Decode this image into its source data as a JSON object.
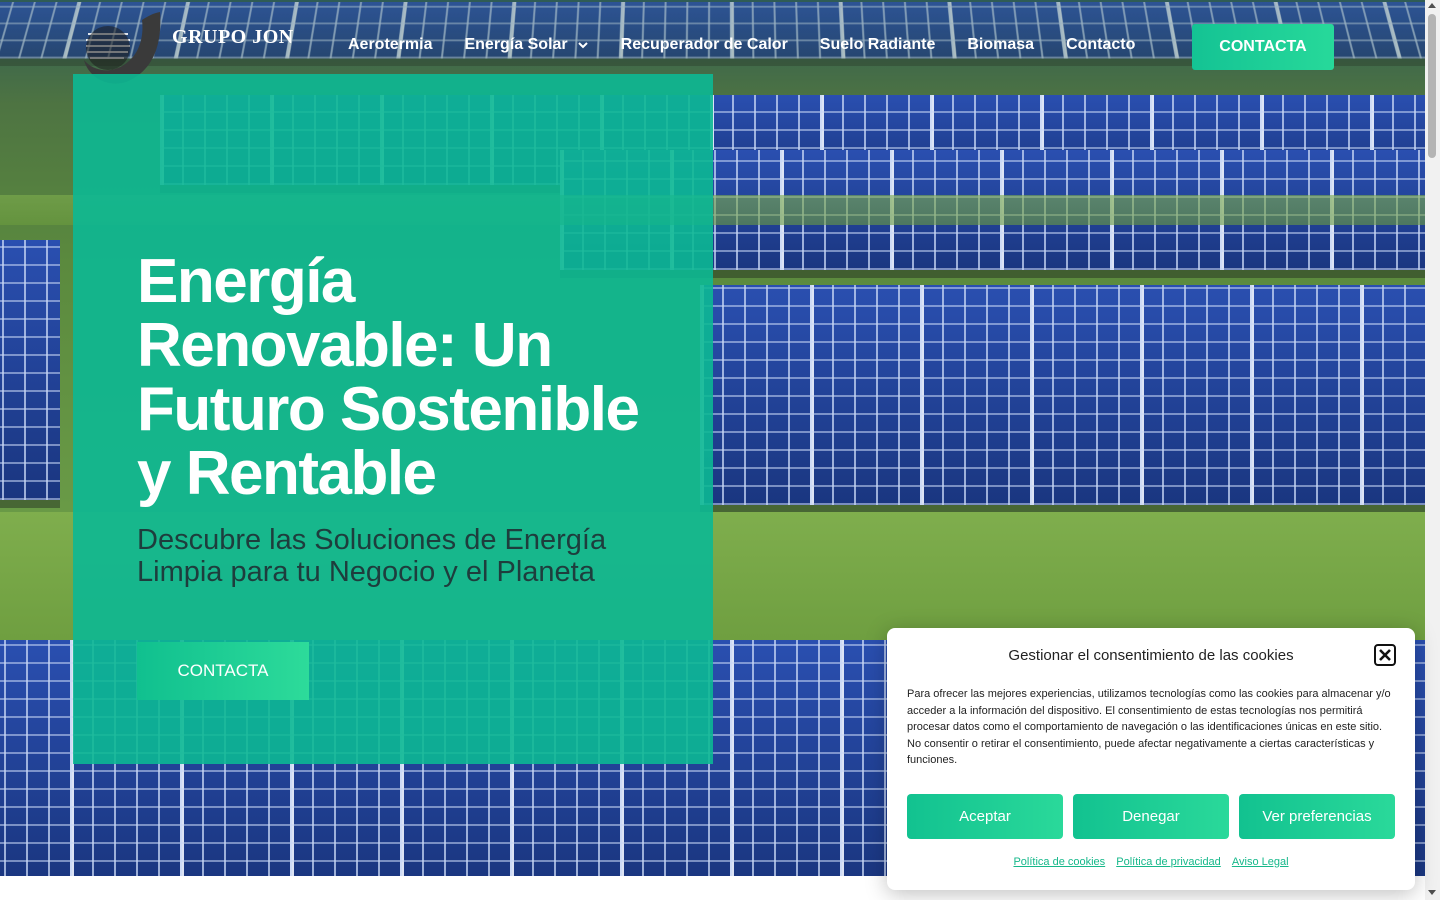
{
  "header": {
    "logo_text": "GRUPO JON",
    "nav": [
      {
        "label": "Aerotermia"
      },
      {
        "label": "Energía Solar",
        "has_dropdown": true
      },
      {
        "label": "Recuperador de Calor"
      },
      {
        "label": "Suelo Radiante"
      },
      {
        "label": "Biomasa"
      },
      {
        "label": "Contacto"
      }
    ],
    "cta_label": "CONTACTA"
  },
  "hero": {
    "title": "Energía Renovable: Un Futuro Sostenible y Rentable",
    "subtitle": "Descubre las Soluciones de Energía Limpia para tu Negocio y el Planeta",
    "cta_label": "CONTACTA"
  },
  "cookie_dialog": {
    "title": "Gestionar el consentimiento de las cookies",
    "text": "Para ofrecer las mejores experiencias, utilizamos tecnologías como las cookies para almacenar y/o acceder a la información del dispositivo. El consentimiento de estas tecnologías nos permitirá procesar datos como el comportamiento de navegación o las identificaciones únicas en este sitio. No consentir o retirar el consentimiento, puede afectar negativamente a ciertas características y funciones.",
    "buttons": {
      "accept": "Aceptar",
      "deny": "Denegar",
      "preferences": "Ver preferencias"
    },
    "links": {
      "cookie_policy": "Política de cookies",
      "privacy_policy": "Política de privacidad",
      "legal_notice": "Aviso Legal"
    }
  },
  "colors": {
    "accent": "#14c394",
    "card_overlay": "#0cb894",
    "subtitle_text": "#1e3d3d",
    "link": "#16b88a"
  },
  "icons": {
    "dropdown": "chevron-down-icon",
    "close": "close-icon"
  }
}
